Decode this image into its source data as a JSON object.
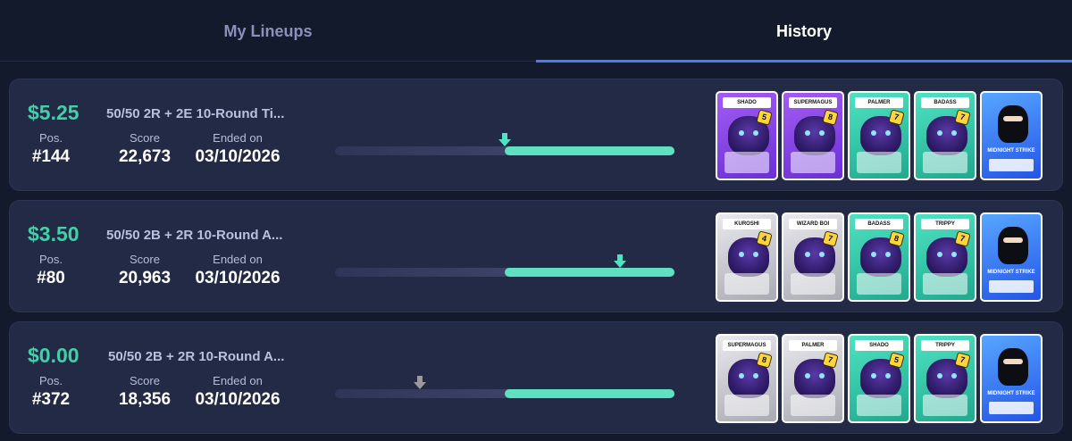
{
  "tabs": [
    {
      "label": "My Lineups",
      "active": false
    },
    {
      "label": "History",
      "active": true
    }
  ],
  "labels": {
    "pos": "Pos.",
    "score": "Score",
    "ended": "Ended on"
  },
  "rows": [
    {
      "prize": "$5.25",
      "contest": "50/50 2R + 2E 10-Round Ti...",
      "pos": "#144",
      "score": "22,673",
      "ended": "03/10/2026",
      "payout_line_fraction": 0.5,
      "marker_fraction": 0.5,
      "marker_color": "#4fe2c2",
      "cards": [
        {
          "name": "SHADO",
          "rarity": "purple",
          "level": "5"
        },
        {
          "name": "SUPERMAGUS",
          "rarity": "purple",
          "level": "8"
        },
        {
          "name": "PALMER",
          "rarity": "teal",
          "level": "7"
        },
        {
          "name": "BADASS",
          "rarity": "teal",
          "level": "7"
        },
        {
          "name": "MIDNIGHT STRIKE",
          "rarity": "blue",
          "level": ""
        }
      ]
    },
    {
      "prize": "$3.50",
      "contest": "50/50 2B + 2R 10-Round A...",
      "pos": "#80",
      "score": "20,963",
      "ended": "03/10/2026",
      "payout_line_fraction": 0.5,
      "marker_fraction": 0.84,
      "marker_color": "#4fe2c2",
      "cards": [
        {
          "name": "KUROSHI",
          "rarity": "silver",
          "level": "4"
        },
        {
          "name": "WIZARD BOI",
          "rarity": "silver",
          "level": "7"
        },
        {
          "name": "BADASS",
          "rarity": "teal",
          "level": "8"
        },
        {
          "name": "TRIPPY",
          "rarity": "teal",
          "level": "7"
        },
        {
          "name": "MIDNIGHT STRIKE",
          "rarity": "blue",
          "level": ""
        }
      ]
    },
    {
      "prize": "$0.00",
      "contest": "50/50 2B + 2R 10-Round A...",
      "pos": "#372",
      "score": "18,356",
      "ended": "03/10/2026",
      "payout_line_fraction": 0.5,
      "marker_fraction": 0.25,
      "marker_color": "#9a9a9a",
      "cards": [
        {
          "name": "SUPERMAGUS",
          "rarity": "silver",
          "level": "8"
        },
        {
          "name": "PALMER",
          "rarity": "silver",
          "level": "7"
        },
        {
          "name": "SHADO",
          "rarity": "teal",
          "level": "5"
        },
        {
          "name": "TRIPPY",
          "rarity": "teal",
          "level": "7"
        },
        {
          "name": "MIDNIGHT STRIKE",
          "rarity": "blue",
          "level": ""
        }
      ]
    }
  ],
  "colors": {
    "accent": "#4a7df0",
    "prize": "#3fd1a8",
    "bar_fill": "#5fe0c0"
  }
}
